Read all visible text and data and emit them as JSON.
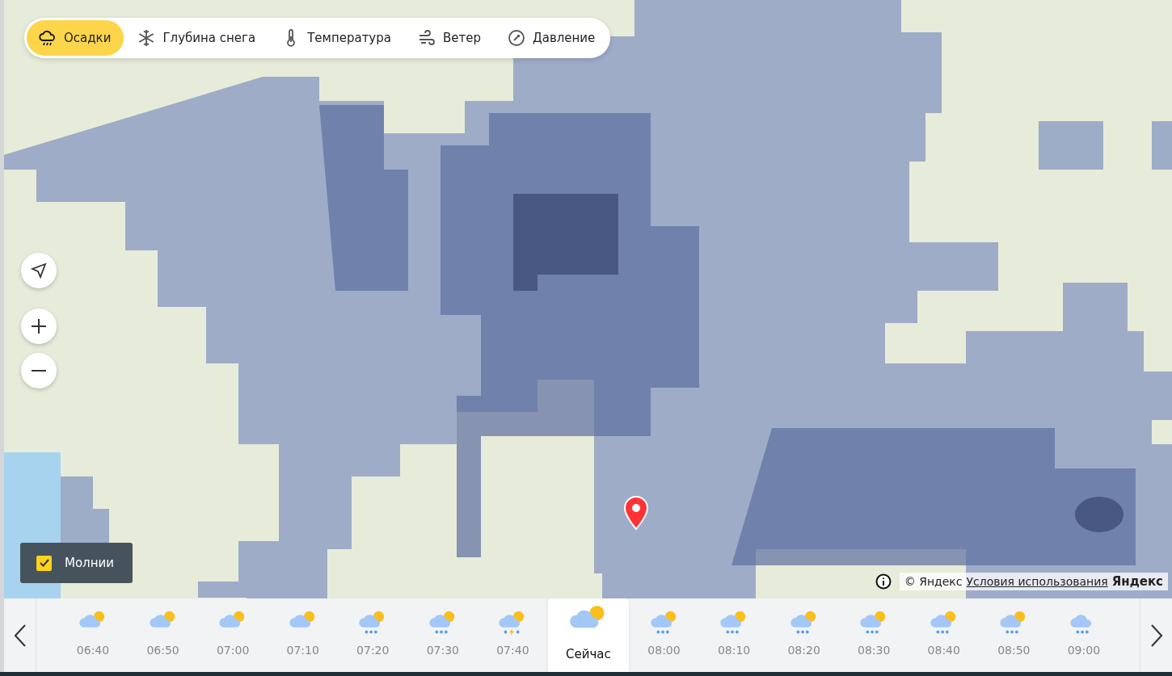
{
  "layers": [
    {
      "kind": "precipitation",
      "label": "Осадки",
      "selected": true
    },
    {
      "kind": "snow",
      "label": "Глубина снега",
      "selected": false
    },
    {
      "kind": "temperature",
      "label": "Температура",
      "selected": false
    },
    {
      "kind": "wind",
      "label": "Ветер",
      "selected": false
    },
    {
      "kind": "pressure",
      "label": "Давление",
      "selected": false
    }
  ],
  "lightning": {
    "label": "Молнии",
    "checked": true
  },
  "attribution": {
    "copyright": "© Яндекс",
    "terms_link": "Условия использования",
    "logo": "Яндекс"
  },
  "timeline": [
    {
      "time": "06:40",
      "kind": "partly-cloudy",
      "selected": false
    },
    {
      "time": "06:50",
      "kind": "partly-cloudy",
      "selected": false
    },
    {
      "time": "07:00",
      "kind": "partly-cloudy",
      "selected": false
    },
    {
      "time": "07:10",
      "kind": "partly-cloudy",
      "selected": false
    },
    {
      "time": "07:20",
      "kind": "rain-sun",
      "selected": false
    },
    {
      "time": "07:30",
      "kind": "rain-sun",
      "selected": false
    },
    {
      "time": "07:40",
      "kind": "storm",
      "selected": false
    },
    {
      "time": "Сейчас",
      "kind": "partly-cloudy",
      "selected": true
    },
    {
      "time": "08:00",
      "kind": "rain-sun",
      "selected": false
    },
    {
      "time": "08:10",
      "kind": "rain-sun",
      "selected": false
    },
    {
      "time": "08:20",
      "kind": "rain-sun",
      "selected": false
    },
    {
      "time": "08:30",
      "kind": "rain-sun",
      "selected": false
    },
    {
      "time": "08:40",
      "kind": "rain-sun",
      "selected": false
    },
    {
      "time": "08:50",
      "kind": "rain-sun",
      "selected": false
    },
    {
      "time": "09:00",
      "kind": "rain",
      "selected": false
    }
  ]
}
